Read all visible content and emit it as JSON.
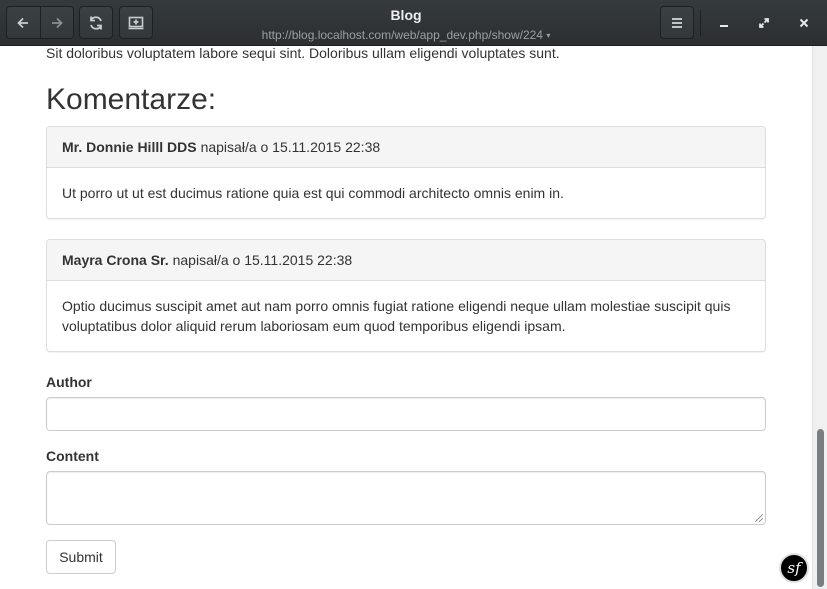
{
  "window": {
    "title": "Blog",
    "url": "http://blog.localhost.com/web/app_dev.php/show/224",
    "url_caret": "▾",
    "buttons": {
      "back_icon": "arrow-left-icon",
      "forward_icon": "arrow-right-icon",
      "reload_icon": "reload-icon",
      "bookmark_icon": "bookmark-add-icon",
      "menu_icon": "hamburger-menu-icon",
      "minimize_icon": "minimize-icon",
      "maximize_icon": "maximize-icon",
      "close_icon": "close-icon"
    }
  },
  "page": {
    "intro_text": "Sit doloribus voluptatem labore sequi sint. Doloribus ullam eligendi voluptates sunt.",
    "comments_heading": "Komentarze:",
    "comments": [
      {
        "author": "Mr. Donnie Hilll DDS",
        "meta": "napisał/a o 15.11.2015 22:38",
        "body": "Ut porro ut ut est ducimus ratione quia est qui commodi architecto omnis enim in."
      },
      {
        "author": "Mayra Crona Sr.",
        "meta": "napisał/a o 15.11.2015 22:38",
        "body": "Optio ducimus suscipit amet aut nam porro omnis fugiat ratione eligendi neque ullam molestiae suscipit quis voluptatibus dolor aliquid rerum laboriosam eum quod temporibus eligendi ipsam."
      }
    ],
    "form": {
      "author_label": "Author",
      "author_value": "",
      "content_label": "Content",
      "content_value": "",
      "submit_label": "Submit"
    }
  },
  "debug_badge": {
    "icon": "symfony-icon",
    "glyph": "sf"
  },
  "colors": {
    "titlebar": "#2f3436",
    "panel_heading_bg": "#f5f5f5",
    "border": "#dddddd",
    "text": "#333333"
  }
}
